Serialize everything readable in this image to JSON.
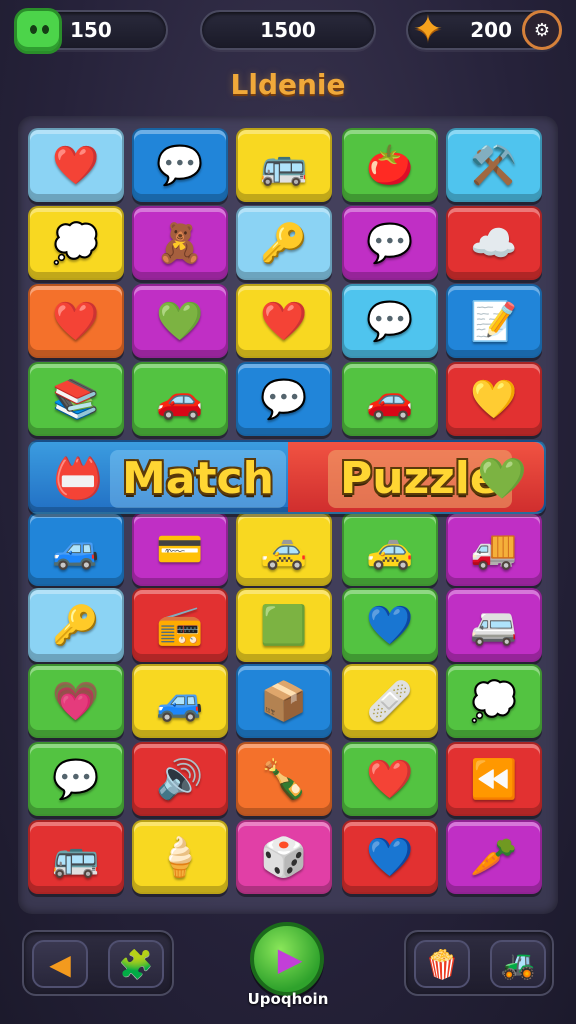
{
  "hud": {
    "coins": "150",
    "score": "1500",
    "stars": "200"
  },
  "title": "Lldenie",
  "banner": {
    "left_word": "Match",
    "right_word": "Puzzle"
  },
  "bottom": {
    "play_label": "Upoqhoin"
  },
  "colors": {
    "lightblue": "#8bd3f4",
    "blue": "#2185d9",
    "yellow": "#f8d821",
    "green": "#53c341",
    "cyan": "#4fc4ee",
    "magenta": "#c02fc5",
    "red": "#e23131",
    "orange": "#f4712b",
    "pink": "#e13fa6"
  },
  "board": {
    "columns": 5,
    "rows": [
      [
        {
          "color": "lightblue",
          "icon": "heart-icon",
          "glyph": "❤️"
        },
        {
          "color": "blue",
          "icon": "chat-bubble-icon",
          "glyph": "💬"
        },
        {
          "color": "yellow",
          "icon": "bus-icon",
          "glyph": "🚌"
        },
        {
          "color": "green",
          "icon": "tomato-icon",
          "glyph": "🍅"
        },
        {
          "color": "cyan",
          "icon": "tools-icon",
          "glyph": "⚒️"
        }
      ],
      [
        {
          "color": "yellow",
          "icon": "speech-bubble-icon",
          "glyph": "💭"
        },
        {
          "color": "magenta",
          "icon": "character-icon",
          "glyph": "🧸"
        },
        {
          "color": "lightblue",
          "icon": "key-icon",
          "glyph": "🔑"
        },
        {
          "color": "magenta",
          "icon": "chat-bubble-icon",
          "glyph": "💬"
        },
        {
          "color": "red",
          "icon": "cloud-icon",
          "glyph": "☁️"
        }
      ],
      [
        {
          "color": "orange",
          "icon": "heart-icon",
          "glyph": "❤️"
        },
        {
          "color": "magenta",
          "icon": "leaf-heart-icon",
          "glyph": "💚"
        },
        {
          "color": "yellow",
          "icon": "heart-icon",
          "glyph": "❤️"
        },
        {
          "color": "cyan",
          "icon": "chat-bubble-icon",
          "glyph": "💬"
        },
        {
          "color": "blue",
          "icon": "note-icon",
          "glyph": "📝"
        }
      ],
      [
        {
          "color": "green",
          "icon": "books-icon",
          "glyph": "📚"
        },
        {
          "color": "green",
          "icon": "car-icon",
          "glyph": "🚗"
        },
        {
          "color": "blue",
          "icon": "chat-bubble-icon",
          "glyph": "💬"
        },
        {
          "color": "green",
          "icon": "car-icon",
          "glyph": "🚗"
        },
        {
          "color": "red",
          "icon": "heart-icon",
          "glyph": "💛"
        }
      ],
      [
        {
          "color": "blue",
          "icon": "car-icon",
          "glyph": "🚙"
        },
        {
          "color": "magenta",
          "icon": "card-icon",
          "glyph": "💳"
        },
        {
          "color": "yellow",
          "icon": "car-icon",
          "glyph": "🚕"
        },
        {
          "color": "green",
          "icon": "car-icon",
          "glyph": "🚕"
        },
        {
          "color": "magenta",
          "icon": "truck-icon",
          "glyph": "🚚"
        }
      ],
      [
        {
          "color": "lightblue",
          "icon": "key-icon",
          "glyph": "🔑"
        },
        {
          "color": "red",
          "icon": "radio-icon",
          "glyph": "📻"
        },
        {
          "color": "yellow",
          "icon": "block-icon",
          "glyph": "🟩"
        },
        {
          "color": "green",
          "icon": "heart-icon",
          "glyph": "💙"
        },
        {
          "color": "magenta",
          "icon": "van-icon",
          "glyph": "🚐"
        }
      ],
      [
        {
          "color": "green",
          "icon": "heart-icon",
          "glyph": "💗"
        },
        {
          "color": "yellow",
          "icon": "car-icon",
          "glyph": "🚙"
        },
        {
          "color": "blue",
          "icon": "box-icon",
          "glyph": "📦"
        },
        {
          "color": "yellow",
          "icon": "eraser-icon",
          "glyph": "🩹"
        },
        {
          "color": "green",
          "icon": "speech-bubble-icon",
          "glyph": "💭"
        }
      ],
      [
        {
          "color": "green",
          "icon": "chat-bubble-icon",
          "glyph": "💬"
        },
        {
          "color": "red",
          "icon": "speaker-icon",
          "glyph": "🔊"
        },
        {
          "color": "orange",
          "icon": "bottle-icon",
          "glyph": "🍾"
        },
        {
          "color": "green",
          "icon": "heart-icon",
          "glyph": "❤️"
        },
        {
          "color": "red",
          "icon": "arrows-icon",
          "glyph": "⏪"
        }
      ],
      [
        {
          "color": "red",
          "icon": "bus-icon",
          "glyph": "🚌"
        },
        {
          "color": "yellow",
          "icon": "ice-cream-icon",
          "glyph": "🍦"
        },
        {
          "color": "pink",
          "icon": "dice-icon",
          "glyph": "🎲"
        },
        {
          "color": "red",
          "icon": "heart-icon",
          "glyph": "💙"
        },
        {
          "color": "magenta",
          "icon": "carrot-icon",
          "glyph": "🥕"
        }
      ]
    ]
  },
  "banner_icons": {
    "left": {
      "icon": "card-icon",
      "glyph": "📛"
    },
    "right": {
      "icon": "heart-icon",
      "glyph": "💚"
    }
  },
  "bottom_buttons": [
    {
      "icon": "arrow-icon",
      "glyph": "◀"
    },
    {
      "icon": "puzzle-piece-icon",
      "glyph": "🧩"
    },
    {
      "icon": "popcorn-icon",
      "glyph": "🍿"
    },
    {
      "icon": "truck-icon",
      "glyph": "🚜"
    }
  ]
}
